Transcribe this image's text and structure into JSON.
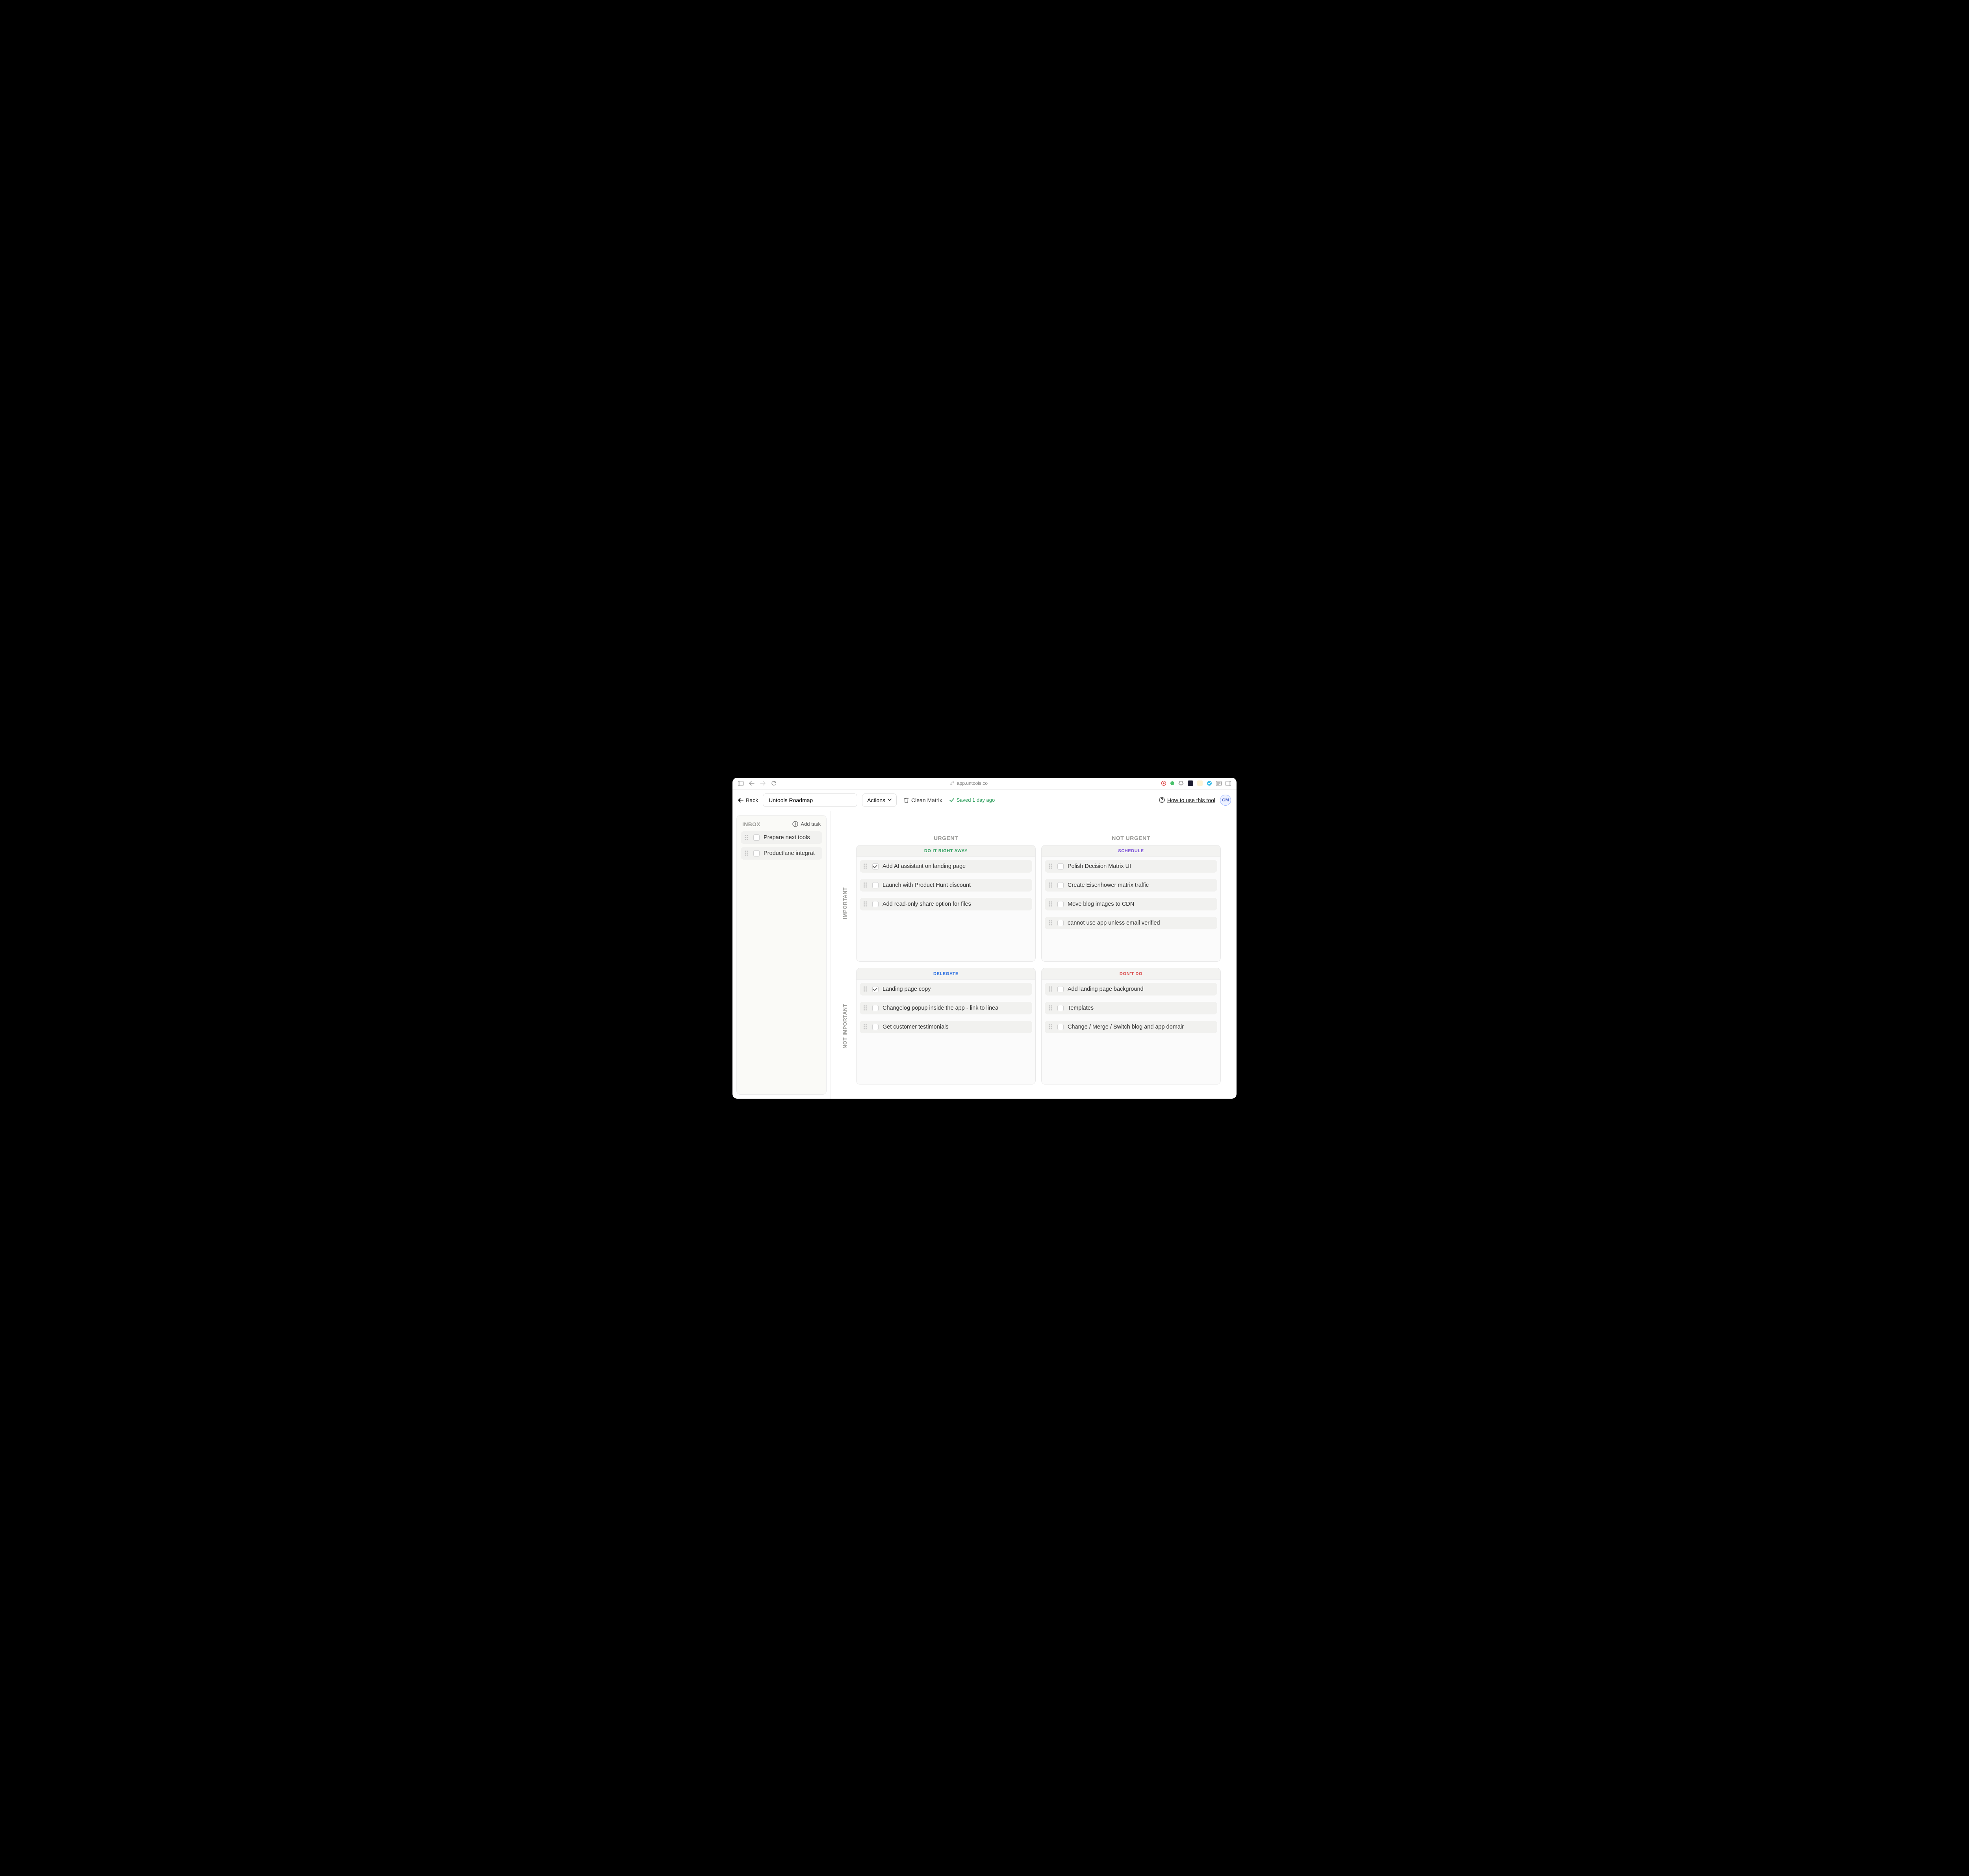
{
  "browser": {
    "url": "app.untools.co"
  },
  "toolbar": {
    "back_label": "Back",
    "title_value": "Untools Roadmap",
    "actions_label": "Actions",
    "clean_label": "Clean Matrix",
    "saved_label": "Saved 1 day ago",
    "howto_label": "How to use this tool",
    "avatar_initials": "GM"
  },
  "inbox": {
    "title": "INBOX",
    "add_task_label": "Add task",
    "tasks": [
      {
        "label": "Prepare next tools",
        "checked": false
      },
      {
        "label": "Productlane integrat",
        "checked": false
      }
    ]
  },
  "matrix": {
    "col_urgent": "URGENT",
    "col_not_urgent": "NOT URGENT",
    "row_important": "IMPORTANT",
    "row_not_important": "NOT IMPORTANT",
    "quadrants": {
      "do": {
        "title": "DO IT RIGHT AWAY",
        "tasks": [
          {
            "label": "Add AI assistant on landing page",
            "checked": true
          },
          {
            "label": "Launch with Product Hunt discount",
            "checked": false
          },
          {
            "label": "Add read-only share option for files",
            "checked": false
          }
        ]
      },
      "schedule": {
        "title": "SCHEDULE",
        "tasks": [
          {
            "label": "Polish Decision Matrix UI",
            "checked": false
          },
          {
            "label": "Create Eisenhower matrix traffic",
            "checked": false
          },
          {
            "label": "Move blog images to CDN",
            "checked": false
          },
          {
            "label": "cannot use app unless email verified",
            "checked": false
          }
        ]
      },
      "delegate": {
        "title": "DELEGATE",
        "tasks": [
          {
            "label": "Landing page copy",
            "checked": true
          },
          {
            "label": "Changelog popup inside the app - link to linea",
            "checked": false
          },
          {
            "label": "Get customer testimonials",
            "checked": false
          }
        ]
      },
      "dont": {
        "title": "DON'T DO",
        "tasks": [
          {
            "label": "Add landing page background",
            "checked": false
          },
          {
            "label": "Templates",
            "checked": false
          },
          {
            "label": "Change / Merge / Switch blog and app domair",
            "checked": false
          }
        ]
      }
    }
  }
}
